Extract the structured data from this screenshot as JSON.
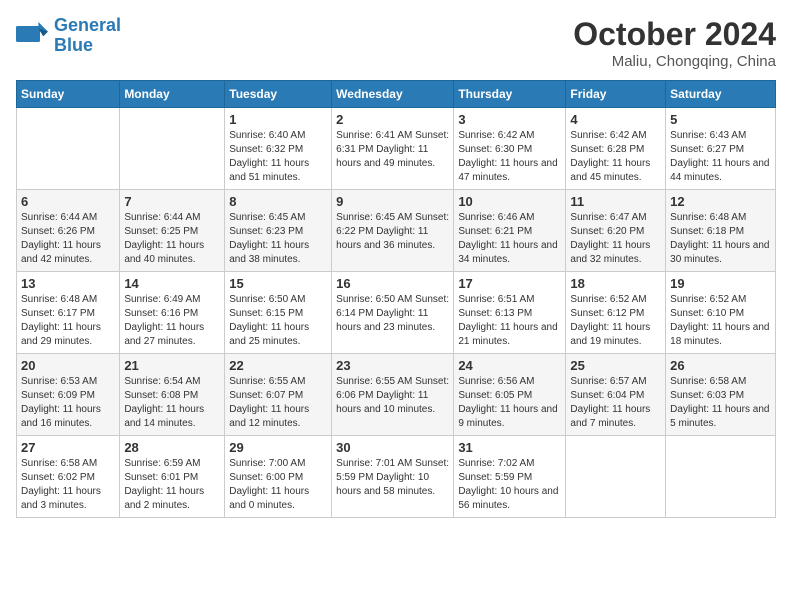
{
  "header": {
    "logo_line1": "General",
    "logo_line2": "Blue",
    "month_title": "October 2024",
    "location": "Maliu, Chongqing, China"
  },
  "weekdays": [
    "Sunday",
    "Monday",
    "Tuesday",
    "Wednesday",
    "Thursday",
    "Friday",
    "Saturday"
  ],
  "weeks": [
    [
      {
        "day": "",
        "info": ""
      },
      {
        "day": "",
        "info": ""
      },
      {
        "day": "1",
        "info": "Sunrise: 6:40 AM\nSunset: 6:32 PM\nDaylight: 11 hours\nand 51 minutes."
      },
      {
        "day": "2",
        "info": "Sunrise: 6:41 AM\nSunset: 6:31 PM\nDaylight: 11 hours\nand 49 minutes."
      },
      {
        "day": "3",
        "info": "Sunrise: 6:42 AM\nSunset: 6:30 PM\nDaylight: 11 hours\nand 47 minutes."
      },
      {
        "day": "4",
        "info": "Sunrise: 6:42 AM\nSunset: 6:28 PM\nDaylight: 11 hours\nand 45 minutes."
      },
      {
        "day": "5",
        "info": "Sunrise: 6:43 AM\nSunset: 6:27 PM\nDaylight: 11 hours\nand 44 minutes."
      }
    ],
    [
      {
        "day": "6",
        "info": "Sunrise: 6:44 AM\nSunset: 6:26 PM\nDaylight: 11 hours\nand 42 minutes."
      },
      {
        "day": "7",
        "info": "Sunrise: 6:44 AM\nSunset: 6:25 PM\nDaylight: 11 hours\nand 40 minutes."
      },
      {
        "day": "8",
        "info": "Sunrise: 6:45 AM\nSunset: 6:23 PM\nDaylight: 11 hours\nand 38 minutes."
      },
      {
        "day": "9",
        "info": "Sunrise: 6:45 AM\nSunset: 6:22 PM\nDaylight: 11 hours\nand 36 minutes."
      },
      {
        "day": "10",
        "info": "Sunrise: 6:46 AM\nSunset: 6:21 PM\nDaylight: 11 hours\nand 34 minutes."
      },
      {
        "day": "11",
        "info": "Sunrise: 6:47 AM\nSunset: 6:20 PM\nDaylight: 11 hours\nand 32 minutes."
      },
      {
        "day": "12",
        "info": "Sunrise: 6:48 AM\nSunset: 6:18 PM\nDaylight: 11 hours\nand 30 minutes."
      }
    ],
    [
      {
        "day": "13",
        "info": "Sunrise: 6:48 AM\nSunset: 6:17 PM\nDaylight: 11 hours\nand 29 minutes."
      },
      {
        "day": "14",
        "info": "Sunrise: 6:49 AM\nSunset: 6:16 PM\nDaylight: 11 hours\nand 27 minutes."
      },
      {
        "day": "15",
        "info": "Sunrise: 6:50 AM\nSunset: 6:15 PM\nDaylight: 11 hours\nand 25 minutes."
      },
      {
        "day": "16",
        "info": "Sunrise: 6:50 AM\nSunset: 6:14 PM\nDaylight: 11 hours\nand 23 minutes."
      },
      {
        "day": "17",
        "info": "Sunrise: 6:51 AM\nSunset: 6:13 PM\nDaylight: 11 hours\nand 21 minutes."
      },
      {
        "day": "18",
        "info": "Sunrise: 6:52 AM\nSunset: 6:12 PM\nDaylight: 11 hours\nand 19 minutes."
      },
      {
        "day": "19",
        "info": "Sunrise: 6:52 AM\nSunset: 6:10 PM\nDaylight: 11 hours\nand 18 minutes."
      }
    ],
    [
      {
        "day": "20",
        "info": "Sunrise: 6:53 AM\nSunset: 6:09 PM\nDaylight: 11 hours\nand 16 minutes."
      },
      {
        "day": "21",
        "info": "Sunrise: 6:54 AM\nSunset: 6:08 PM\nDaylight: 11 hours\nand 14 minutes."
      },
      {
        "day": "22",
        "info": "Sunrise: 6:55 AM\nSunset: 6:07 PM\nDaylight: 11 hours\nand 12 minutes."
      },
      {
        "day": "23",
        "info": "Sunrise: 6:55 AM\nSunset: 6:06 PM\nDaylight: 11 hours\nand 10 minutes."
      },
      {
        "day": "24",
        "info": "Sunrise: 6:56 AM\nSunset: 6:05 PM\nDaylight: 11 hours\nand 9 minutes."
      },
      {
        "day": "25",
        "info": "Sunrise: 6:57 AM\nSunset: 6:04 PM\nDaylight: 11 hours\nand 7 minutes."
      },
      {
        "day": "26",
        "info": "Sunrise: 6:58 AM\nSunset: 6:03 PM\nDaylight: 11 hours\nand 5 minutes."
      }
    ],
    [
      {
        "day": "27",
        "info": "Sunrise: 6:58 AM\nSunset: 6:02 PM\nDaylight: 11 hours\nand 3 minutes."
      },
      {
        "day": "28",
        "info": "Sunrise: 6:59 AM\nSunset: 6:01 PM\nDaylight: 11 hours\nand 2 minutes."
      },
      {
        "day": "29",
        "info": "Sunrise: 7:00 AM\nSunset: 6:00 PM\nDaylight: 11 hours\nand 0 minutes."
      },
      {
        "day": "30",
        "info": "Sunrise: 7:01 AM\nSunset: 5:59 PM\nDaylight: 10 hours\nand 58 minutes."
      },
      {
        "day": "31",
        "info": "Sunrise: 7:02 AM\nSunset: 5:59 PM\nDaylight: 10 hours\nand 56 minutes."
      },
      {
        "day": "",
        "info": ""
      },
      {
        "day": "",
        "info": ""
      }
    ]
  ]
}
